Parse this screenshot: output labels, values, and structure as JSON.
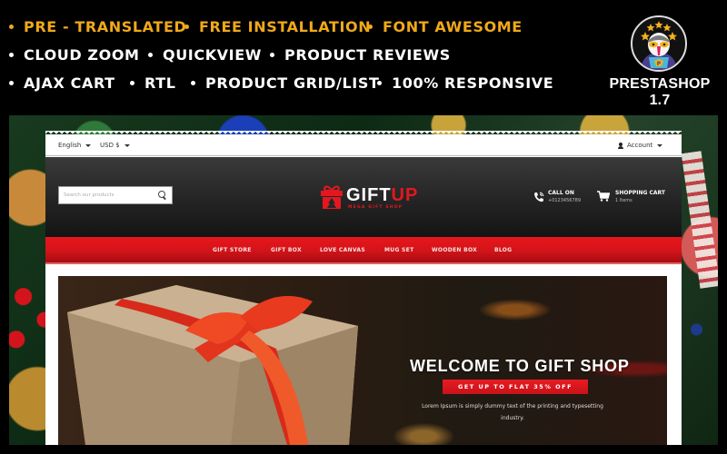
{
  "features": {
    "row1": [
      {
        "label": "PRE - TRANSLATED",
        "color": "#f0a91a"
      },
      {
        "label": "FREE INSTALLATION",
        "color": "#f0a91a"
      },
      {
        "label": "FONT AWESOME",
        "color": "#f0a91a"
      }
    ],
    "row2": [
      {
        "label": "CLOUD ZOOM",
        "color": "#ffffff"
      },
      {
        "label": "QUICKVIEW",
        "color": "#ffffff"
      },
      {
        "label": "PRODUCT REVIEWS",
        "color": "#ffffff"
      }
    ],
    "row3": [
      {
        "label": "AJAX CART",
        "color": "#ffffff"
      },
      {
        "label": "RTL",
        "color": "#ffffff"
      },
      {
        "label": "PRODUCT GRID/LIST",
        "color": "#ffffff"
      },
      {
        "label": "100% RESPONSIVE",
        "color": "#ffffff"
      }
    ]
  },
  "platform": {
    "badge_icon": "prestashop-puffin-icon",
    "version_label": "PRESTASHOP 1.7"
  },
  "store": {
    "topbar": {
      "language": "English",
      "currency": "USD $",
      "account": "Account"
    },
    "search": {
      "placeholder": "Search our products",
      "value": ""
    },
    "logo": {
      "name_white": "GIFT",
      "name_red": "UP",
      "tagline": "MEGA GIFT SHOP"
    },
    "call": {
      "title": "CALL ON",
      "number": "+0123456789"
    },
    "cart": {
      "title": "SHOPPING CART",
      "count": "1 Items"
    },
    "nav": [
      "GIFT STORE",
      "GIFT BOX",
      "LOVE CANVAS",
      "MUG SET",
      "WOODEN BOX",
      "BLOG"
    ],
    "hero": {
      "title": "WELCOME TO GIFT SHOP",
      "button": "GET UP TO FLAT 35% OFF",
      "text": "Lorem Ipsum is simply dummy text of the printing and typesetting industry."
    }
  },
  "colors": {
    "accent_gold": "#f0a91a",
    "brand_red": "#e3181f",
    "header_dark": "#262626"
  }
}
